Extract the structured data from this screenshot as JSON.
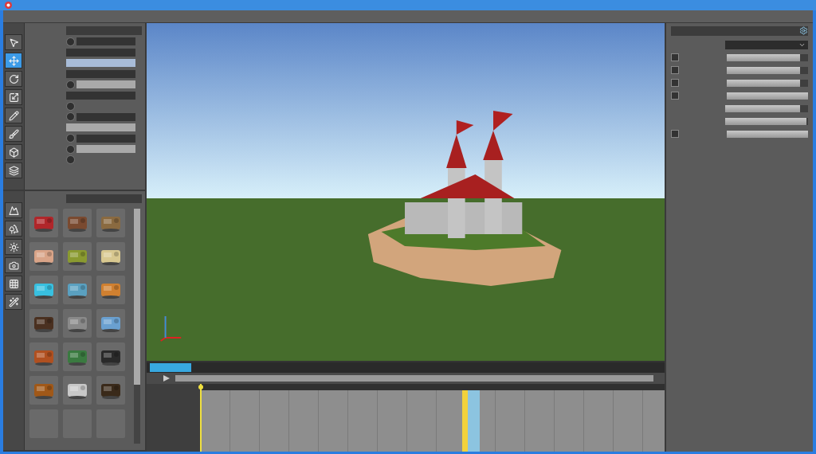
{
  "tools_top": [
    {
      "selected": false
    },
    {
      "selected": true
    },
    {
      "selected": false
    },
    {
      "selected": false
    },
    {
      "selected": false
    },
    {
      "selected": false
    },
    {
      "selected": false
    },
    {
      "selected": false
    }
  ],
  "tools_bottom": [
    {
      "selected": false
    },
    {
      "selected": false
    },
    {
      "selected": false
    },
    {
      "selected": false
    },
    {
      "selected": false
    },
    {
      "selected": false
    }
  ],
  "properties": [
    {
      "kind": "knob-dark"
    },
    {
      "kind": "dark-field"
    },
    {
      "kind": "color-field"
    },
    {
      "kind": "dark-field"
    },
    {
      "kind": "knob-light"
    },
    {
      "kind": "dark-field"
    },
    {
      "kind": "knob"
    },
    {
      "kind": "knob-dark"
    },
    {
      "kind": "light-field"
    },
    {
      "kind": "knob-dark"
    },
    {
      "kind": "knob-light"
    },
    {
      "kind": "knob"
    }
  ],
  "assets": [
    {
      "kind": "picture",
      "color": "#b0262a"
    },
    {
      "kind": "picture",
      "color": "#7a4a30"
    },
    {
      "kind": "picture",
      "color": "#8a6a40"
    },
    {
      "kind": "picture",
      "color": "#d9a488"
    },
    {
      "kind": "picture",
      "color": "#8a9a30"
    },
    {
      "kind": "picture",
      "color": "#d8c890"
    },
    {
      "kind": "picture",
      "color": "#38c0e0"
    },
    {
      "kind": "picture",
      "color": "#5aa0c0"
    },
    {
      "kind": "picture",
      "color": "#d08030"
    },
    {
      "kind": "picture",
      "color": "#4a3020"
    },
    {
      "kind": "picture",
      "color": "#8a8a8a"
    },
    {
      "kind": "picture",
      "color": "#6aa0d0"
    },
    {
      "kind": "picture",
      "color": "#b05020"
    },
    {
      "kind": "picture",
      "color": "#3a7a40"
    },
    {
      "kind": "picture",
      "color": "#2a2a2a"
    },
    {
      "kind": "picture",
      "color": "#a05818"
    },
    {
      "kind": "picture",
      "color": "#c8c8c8"
    },
    {
      "kind": "picture",
      "color": "#3a2a1a"
    },
    {
      "kind": "empty"
    },
    {
      "kind": "empty"
    },
    {
      "kind": "empty"
    }
  ],
  "inspector": [
    {
      "kind": "dropdown"
    },
    {
      "kind": "checkbox-slider",
      "level": 0.9
    },
    {
      "kind": "checkbox-slider",
      "level": 0.9
    },
    {
      "kind": "checkbox-slider",
      "level": 0.9
    },
    {
      "kind": "checkbox-slider",
      "level": 1
    },
    {
      "kind": "slider",
      "level": 0.9
    },
    {
      "kind": "slider",
      "level": 0.98
    },
    {
      "kind": "checkbox-slider",
      "level": 1
    }
  ],
  "timeline": {
    "playhead": {
      "level": 0
    },
    "columns": [
      {
        "kind": "empty"
      },
      {
        "kind": "empty"
      },
      {
        "kind": "empty"
      },
      {
        "kind": "empty"
      },
      {
        "kind": "empty"
      },
      {
        "kind": "empty"
      },
      {
        "kind": "empty"
      },
      {
        "kind": "empty"
      },
      {
        "kind": "empty"
      },
      {
        "kind": "empty"
      },
      {
        "kind": "empty"
      },
      {
        "kind": "empty"
      },
      {
        "kind": "empty"
      },
      {
        "kind": "empty"
      },
      {
        "kind": "empty"
      },
      {
        "kind": "empty"
      },
      {
        "kind": "empty"
      },
      {
        "kind": "empty"
      },
      {
        "kind": "empty"
      },
      {
        "kind": "empty"
      },
      {
        "kind": "empty"
      },
      {
        "kind": "empty"
      },
      {
        "kind": "empty"
      },
      {
        "kind": "empty"
      },
      {
        "kind": "empty"
      },
      {
        "kind": "empty"
      },
      {
        "kind": "empty"
      },
      {
        "kind": "empty"
      },
      {
        "kind": "empty"
      },
      {
        "kind": "empty"
      },
      {
        "kind": "empty"
      },
      {
        "kind": "empty"
      },
      {
        "kind": "empty"
      },
      {
        "kind": "empty"
      },
      {
        "kind": "empty"
      },
      {
        "kind": "empty"
      },
      {
        "kind": "empty"
      },
      {
        "kind": "empty"
      },
      {
        "kind": "empty"
      },
      {
        "kind": "empty"
      },
      {
        "kind": "empty"
      },
      {
        "kind": "empty"
      },
      {
        "kind": "empty"
      },
      {
        "kind": "empty"
      },
      {
        "kind": "empty"
      },
      {
        "kind": "clip",
        "color": "#f2d23c"
      },
      {
        "kind": "clip",
        "color": "#8cc4e0"
      },
      {
        "kind": "clip",
        "color": "#8cc4e0"
      },
      {
        "kind": "empty"
      },
      {
        "kind": "empty"
      },
      {
        "kind": "empty"
      },
      {
        "kind": "empty"
      },
      {
        "kind": "empty"
      },
      {
        "kind": "empty"
      },
      {
        "kind": "empty"
      },
      {
        "kind": "empty"
      },
      {
        "kind": "empty"
      },
      {
        "kind": "empty"
      },
      {
        "kind": "empty"
      },
      {
        "kind": "empty"
      },
      {
        "kind": "empty"
      },
      {
        "kind": "empty"
      },
      {
        "kind": "empty"
      },
      {
        "kind": "empty"
      },
      {
        "kind": "empty"
      },
      {
        "kind": "empty"
      },
      {
        "kind": "empty"
      },
      {
        "kind": "empty"
      },
      {
        "kind": "empty"
      },
      {
        "kind": "empty"
      },
      {
        "kind": "empty"
      },
      {
        "kind": "empty"
      },
      {
        "kind": "empty"
      },
      {
        "kind": "empty"
      },
      {
        "kind": "empty"
      },
      {
        "kind": "empty"
      },
      {
        "kind": "empty"
      },
      {
        "kind": "empty"
      },
      {
        "kind": "empty"
      },
      {
        "kind": "empty"
      }
    ]
  }
}
